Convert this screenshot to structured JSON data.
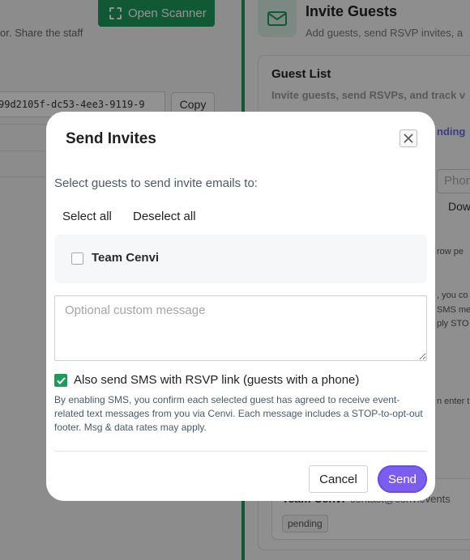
{
  "background": {
    "scanner_button": "Open Scanner",
    "share_hint": "or. Share the staff",
    "uuid_value": "99d2105f-dc53-4ee3-9119-9",
    "copy_button": "Copy",
    "invite_title": "Invite Guests",
    "invite_subtitle": "Add guests, send RSVP invites, a",
    "guest_list_title": "Guest List",
    "guest_list_subtitle": "Invite guests, send RSVPs, and track v",
    "pending_tab": "nding",
    "phone_placeholder": "Phon",
    "download_button": "Dow",
    "peek_1": "row pe",
    "peek_2": ", you co",
    "peek_3": "SMS me",
    "peek_4": "ply STO",
    "peek_5": "n enter t",
    "team_name": "Team Cenvi",
    "team_email": "contact@cenvievents",
    "team_status": "pending"
  },
  "modal": {
    "title": "Send Invites",
    "instructions": "Select guests to send invite emails to:",
    "select_all": "Select all",
    "deselect_all": "Deselect all",
    "guests": [
      {
        "name": "Team Cenvi",
        "checked": false
      }
    ],
    "message_placeholder": "Optional custom message",
    "sms_label": "Also send SMS with RSVP link (guests with a phone)",
    "sms_checked": true,
    "consent_text": "By enabling SMS, you confirm each selected guest has agreed to receive event-related text messages from you via Cenvi. Each message includes a STOP-to-opt-out footer. Msg & data rates may apply.",
    "cancel_button": "Cancel",
    "send_button": "Send"
  },
  "colors": {
    "brand_green": "#1e9a5a",
    "send_purple": "#7b5ef0"
  }
}
